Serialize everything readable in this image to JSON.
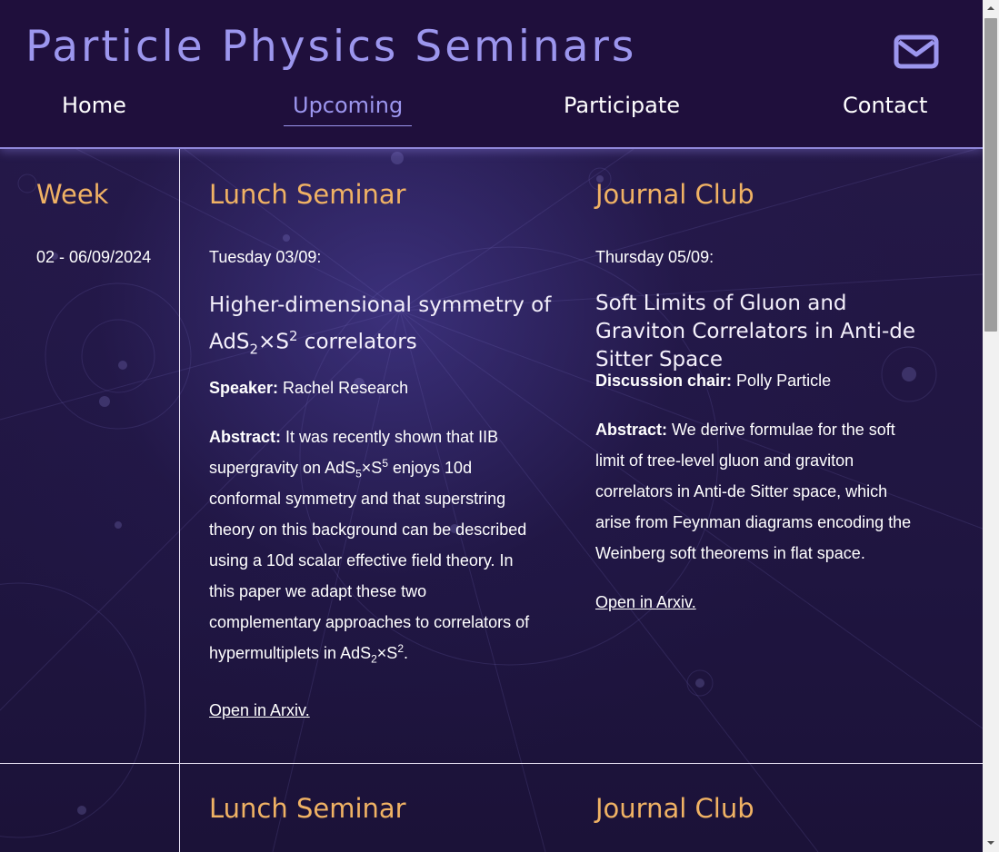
{
  "site": {
    "title": "Particle Physics Seminars",
    "contact_icon": "envelope-icon"
  },
  "nav": {
    "items": [
      {
        "label": "Home"
      },
      {
        "label": "Upcoming",
        "active": true
      },
      {
        "label": "Participate"
      },
      {
        "label": "Contact"
      }
    ]
  },
  "columns": {
    "week": "Week",
    "lunch": "Lunch Seminar",
    "journal": "Journal Club"
  },
  "weeks": [
    {
      "range": "02 - 06/09/2024",
      "lunch": {
        "day": "Tuesday 03/09:",
        "title_line1": "Higher-dimensional symmetry of",
        "title_pre": "AdS",
        "title_sub": "2",
        "title_mid": "×S",
        "title_sup": "2",
        "title_post": " correlators",
        "speaker_label": "Speaker:",
        "speaker": " Rachel Research",
        "abstract_label": "Abstract:",
        "abstract_a": " It was recently shown that IIB supergravity on AdS",
        "abstract_sub1": "5",
        "abstract_b": "×S",
        "abstract_sup1": "5",
        "abstract_c": " enjoys 10d conformal symmetry and that superstring theory on this background can be described using a 10d scalar effective field theory. In this paper we adapt these two complementary approaches to correlators of hypermultiplets in AdS",
        "abstract_sub2": "2",
        "abstract_d": "×S",
        "abstract_sup2": "2",
        "abstract_e": ".",
        "link": "Open in Arxiv."
      },
      "journal": {
        "day": "Thursday 05/09:",
        "title": "Soft Limits of Gluon and Graviton Correlators in Anti-de Sitter Space",
        "chair_label": "Discussion chair:",
        "chair": " Polly Particle",
        "abstract_label": "Abstract:",
        "abstract": " We derive formulae for the soft limit of tree-level gluon and graviton correlators in Anti-de Sitter space, which arise from Feynman diagrams encoding the Weinberg soft theorems in flat space.",
        "link": "Open in Arxiv."
      }
    },
    {
      "lunch_heading": "Lunch Seminar",
      "journal_heading": "Journal Club"
    }
  ]
}
